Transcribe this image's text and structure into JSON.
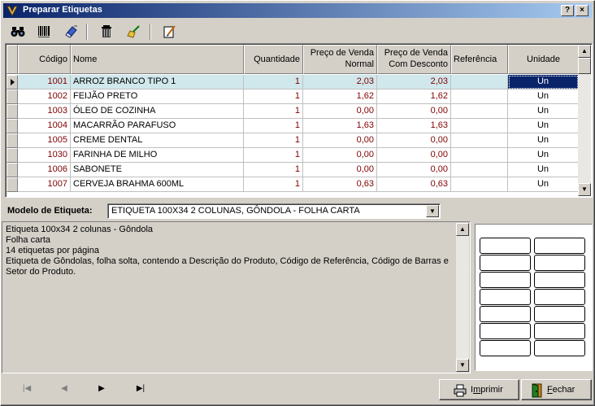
{
  "window": {
    "title": "Preparar Etiquetas"
  },
  "titlebar_buttons": {
    "help": "?",
    "close": "×"
  },
  "toolbar": {
    "items": [
      {
        "name": "binoculars-icon"
      },
      {
        "name": "barcode-icon"
      },
      {
        "name": "eraser-icon"
      },
      {
        "name": "trash-icon"
      },
      {
        "name": "broom-icon"
      },
      {
        "name": "edit-icon"
      }
    ]
  },
  "grid": {
    "headers": {
      "codigo": "Código",
      "nome": "Nome",
      "quantidade": "Quantidade",
      "preco_normal_1": "Preço de Venda",
      "preco_normal_2": "Normal",
      "preco_desc_1": "Preço de Venda",
      "preco_desc_2": "Com Desconto",
      "referencia": "Referência",
      "unidade": "Unidade"
    },
    "rows": [
      {
        "codigo": "1001",
        "nome": "ARROZ BRANCO TIPO 1",
        "quantidade": "1",
        "preco_normal": "2,03",
        "preco_desconto": "2,03",
        "referencia": "",
        "unidade": "Un"
      },
      {
        "codigo": "1002",
        "nome": "FEIJÃO PRETO",
        "quantidade": "1",
        "preco_normal": "1,62",
        "preco_desconto": "1,62",
        "referencia": "",
        "unidade": "Un"
      },
      {
        "codigo": "1003",
        "nome": "ÓLEO DE COZINHA",
        "quantidade": "1",
        "preco_normal": "0,00",
        "preco_desconto": "0,00",
        "referencia": "",
        "unidade": "Un"
      },
      {
        "codigo": "1004",
        "nome": "MACARRÃO PARAFUSO",
        "quantidade": "1",
        "preco_normal": "1,63",
        "preco_desconto": "1,63",
        "referencia": "",
        "unidade": "Un"
      },
      {
        "codigo": "1005",
        "nome": "CREME DENTAL",
        "quantidade": "1",
        "preco_normal": "0,00",
        "preco_desconto": "0,00",
        "referencia": "",
        "unidade": "Un"
      },
      {
        "codigo": "1030",
        "nome": "FARINHA DE MILHO",
        "quantidade": "1",
        "preco_normal": "0,00",
        "preco_desconto": "0,00",
        "referencia": "",
        "unidade": "Un"
      },
      {
        "codigo": "1006",
        "nome": "SABONETE",
        "quantidade": "1",
        "preco_normal": "0,00",
        "preco_desconto": "0,00",
        "referencia": "",
        "unidade": "Un"
      },
      {
        "codigo": "1007",
        "nome": "CERVEJA BRAHMA 600ML",
        "quantidade": "1",
        "preco_normal": "0,63",
        "preco_desconto": "0,63",
        "referencia": "",
        "unidade": "Un"
      }
    ]
  },
  "model": {
    "label": "Modelo de Etiqueta:",
    "selected": "ETIQUETA 100X34 2 COLUNAS, GÔNDOLA  - FOLHA CARTA"
  },
  "description": {
    "lines": [
      "Etiqueta 100x34 2 colunas - Gôndola",
      "Folha carta",
      "14 etiquetas por página",
      "Etiqueta de Gôndolas, folha solta, contendo a Descrição do Produto, Código de Referência, Código de Barras e Setor do Produto."
    ]
  },
  "preview": {
    "columns": 2,
    "rows": 7
  },
  "nav": {
    "first": "|◀",
    "prev": "◀",
    "next": "▶",
    "last": "▶|"
  },
  "buttons": {
    "imprimir": "Imprimir",
    "fechar": "Fechar"
  },
  "colors": {
    "selected_row": "#d0e8ec",
    "selected_cell": "#0a246a",
    "code_red": "#800000"
  }
}
